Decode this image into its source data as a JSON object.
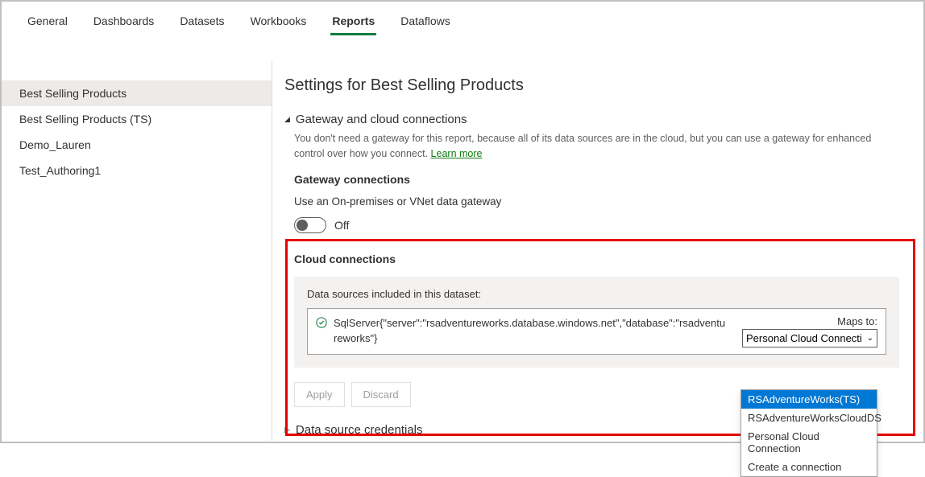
{
  "tabs": [
    "General",
    "Dashboards",
    "Datasets",
    "Workbooks",
    "Reports",
    "Dataflows"
  ],
  "activeTab": 4,
  "sidebar": {
    "items": [
      "Best Selling Products",
      "Best Selling Products (TS)",
      "Demo_Lauren",
      "Test_Authoring1"
    ],
    "selected": 0
  },
  "main": {
    "title": "Settings for Best Selling Products",
    "gateway": {
      "header": "Gateway and cloud connections",
      "desc_prefix": "You don't need a gateway for this report, because all of its data sources are in the cloud, but you can use a gateway for enhanced control over how you connect. ",
      "learn_more": "Learn more",
      "connections_title": "Gateway connections",
      "gateway_desc": "Use an On-premises or VNet data gateway",
      "toggle_state": "Off"
    },
    "cloud": {
      "title": "Cloud connections",
      "box_label": "Data sources included in this dataset:",
      "datasource_text": "SqlServer{\"server\":\"rsadventureworks.database.windows.net\",\"database\":\"rsadventureworks\"}",
      "maps_to_label": "Maps to:",
      "maps_to_value": "Personal Cloud Connecti",
      "dropdown_options": [
        "RSAdventureWorks(TS)",
        "RSAdventureWorksCloudDS",
        "Personal Cloud Connection",
        "Create a connection"
      ],
      "dropdown_highlighted": 0
    },
    "actions": {
      "apply": "Apply",
      "discard": "Discard"
    },
    "credentials_header": "Data source credentials"
  }
}
